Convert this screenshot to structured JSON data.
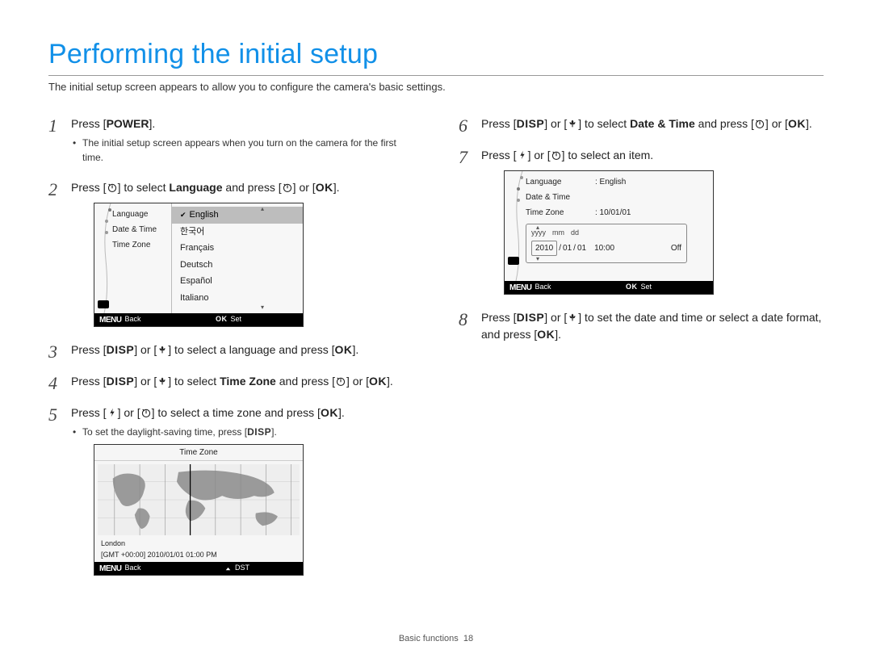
{
  "title": "Performing the initial setup",
  "subtitle": "The initial setup screen appears to allow you to configure the camera's basic settings.",
  "labels": {
    "power": "POWER",
    "disp": "DISP",
    "ok": "OK",
    "menu": "MENU",
    "back": "Back",
    "set": "Set",
    "dst": "DST"
  },
  "steps_left": {
    "s1_pre": "Press [",
    "s1_post": "].",
    "s1_bullet": "The initial setup screen appears when you turn on the camera for the first time.",
    "s2_a": "Press [",
    "s2_b": "] to select ",
    "s2_lang": "Language",
    "s2_c": " and press [",
    "s2_d": "] or [",
    "s2_e": "].",
    "s3_a": "Press [",
    "s3_b": "] or [",
    "s3_c": "] to select a language and press [",
    "s3_d": "].",
    "s4_a": "Press [",
    "s4_b": "] or [",
    "s4_c": "] to select ",
    "s4_tz": "Time Zone",
    "s4_d": " and press [",
    "s4_e": "] or [",
    "s4_f": "].",
    "s5_a": "Press [",
    "s5_b": "] or [",
    "s5_c": "] to select a time zone and press [",
    "s5_d": "].",
    "s5_bullet_a": "To set the daylight-saving time, press [",
    "s5_bullet_b": "]."
  },
  "steps_right": {
    "s6_a": "Press [",
    "s6_b": "] or [",
    "s6_c": "] to select ",
    "s6_dt": "Date & Time",
    "s6_d": " and press [",
    "s6_e": "] or [",
    "s6_f": "].",
    "s7_a": "Press [",
    "s7_b": "] or [",
    "s7_c": "] to select an item.",
    "s8_a": "Press [",
    "s8_b": "] or [",
    "s8_c": "] to set the date and time or select a date format, and press [",
    "s8_d": "]."
  },
  "lcd1": {
    "items": [
      "Language",
      "Date & Time",
      "Time Zone"
    ],
    "options": [
      "English",
      "한국어",
      "Français",
      "Deutsch",
      "Español",
      "Italiano"
    ]
  },
  "lcd2": {
    "title": "Time Zone",
    "city": "London",
    "stamp": "[GMT +00:00] 2010/01/01 01:00 PM"
  },
  "lcd3": {
    "rows": {
      "language_label": "Language",
      "language_value": ": English",
      "datetime_label": "Date & Time",
      "tz_label": "Time Zone",
      "tz_value": ": 10/01/01"
    },
    "dt_header": {
      "y": "yyyy",
      "m": "mm",
      "d": "dd"
    },
    "dt_vals": {
      "year": "2010",
      "sep": "/",
      "month": "01",
      "day": "01",
      "time": "10:00",
      "off": "Off"
    }
  },
  "footer": {
    "section": "Basic functions",
    "page": "18"
  }
}
